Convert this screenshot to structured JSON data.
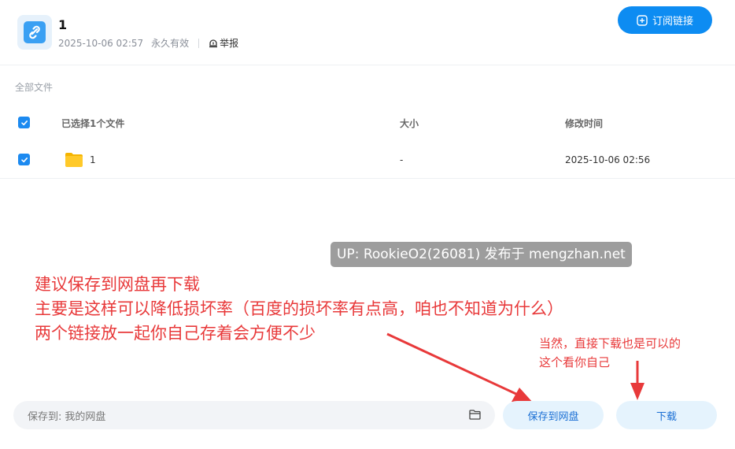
{
  "header": {
    "title": "1",
    "date": "2025-10-06 02:57",
    "validity": "永久有效",
    "report_label": "举报",
    "subscribe_label": "订阅链接"
  },
  "breadcrumb": "全部文件",
  "table": {
    "columns": [
      "已选择1个文件",
      "大小",
      "修改时间"
    ],
    "rows": [
      {
        "name": "1",
        "size": "-",
        "modified": "2025-10-06 02:56",
        "checked": true
      }
    ]
  },
  "bottom": {
    "save_to_label": "保存到:",
    "save_to_value": "我的网盘",
    "save_button": "保存到网盘",
    "download_button": "下载"
  },
  "overlay": {
    "watermark": "UP: RookieO2(26081) 发布于 mengzhan.net",
    "main_lines": [
      "建议保存到网盘再下载",
      "主要是这样可以降低损坏率（百度的损坏率有点高，咱也不知道为什么）",
      "两个链接放一起你自己存着会方便不少"
    ],
    "side_lines": [
      "当然，直接下载也是可以的",
      "这个看你自己"
    ]
  },
  "colors": {
    "accent": "#0d8cf2",
    "annotation": "#e8393a"
  },
  "icons": {
    "file_avatar": "link-icon",
    "report": "report-icon",
    "subscribe": "plus-square-icon",
    "folder": "folder-icon",
    "save_folder": "folder-outline-icon"
  }
}
